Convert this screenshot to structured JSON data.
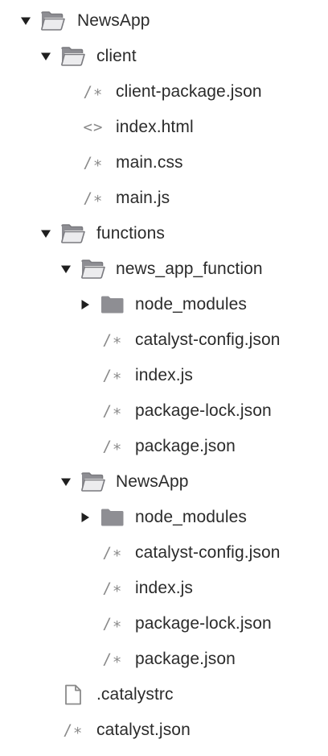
{
  "tree": {
    "root": {
      "name": "NewsApp",
      "icon": "folder-open-icon",
      "children": {
        "client": {
          "name": "client",
          "icon": "folder-open-icon",
          "files": [
            {
              "name": "client-package.json",
              "icon": "comment-code-icon",
              "glyph": "/∗"
            },
            {
              "name": "index.html",
              "icon": "html-code-icon",
              "glyph": "<>"
            },
            {
              "name": "main.css",
              "icon": "comment-code-icon",
              "glyph": "/∗"
            },
            {
              "name": "main.js",
              "icon": "comment-code-icon",
              "glyph": "/∗"
            }
          ]
        },
        "functions": {
          "name": "functions",
          "icon": "folder-open-icon",
          "news_app_function": {
            "name": "news_app_function",
            "icon": "folder-open-icon",
            "node_modules": {
              "name": "node_modules",
              "icon": "folder-closed-icon"
            },
            "files": [
              {
                "name": "catalyst-config.json",
                "icon": "comment-code-icon",
                "glyph": "/∗"
              },
              {
                "name": "index.js",
                "icon": "comment-code-icon",
                "glyph": "/∗"
              },
              {
                "name": "package-lock.json",
                "icon": "comment-code-icon",
                "glyph": "/∗"
              },
              {
                "name": "package.json",
                "icon": "comment-code-icon",
                "glyph": "/∗"
              }
            ]
          },
          "newsapp": {
            "name": "NewsApp",
            "icon": "folder-open-icon",
            "node_modules": {
              "name": "node_modules",
              "icon": "folder-closed-icon"
            },
            "files": [
              {
                "name": "catalyst-config.json",
                "icon": "comment-code-icon",
                "glyph": "/∗"
              },
              {
                "name": "index.js",
                "icon": "comment-code-icon",
                "glyph": "/∗"
              },
              {
                "name": "package-lock.json",
                "icon": "comment-code-icon",
                "glyph": "/∗"
              },
              {
                "name": "package.json",
                "icon": "comment-code-icon",
                "glyph": "/∗"
              }
            ]
          }
        },
        "catalystrc": {
          "name": ".catalystrc",
          "icon": "document-icon"
        },
        "catalyst_json": {
          "name": "catalyst.json",
          "icon": "comment-code-icon",
          "glyph": "/∗"
        }
      }
    }
  },
  "colors": {
    "folder": "#8e8e93",
    "icon_glyph": "#8a8a8a",
    "text": "#2b2b2b",
    "chevron": "#1f1f1f"
  }
}
